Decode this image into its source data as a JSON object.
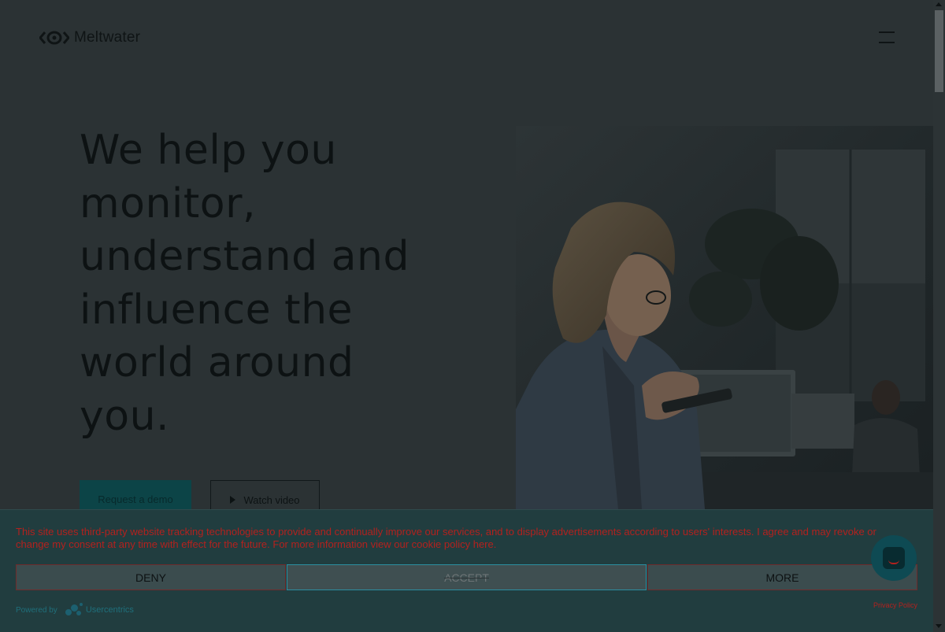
{
  "header": {
    "logo_text": "Meltwater",
    "menu_icon": "hamburger-menu-icon"
  },
  "hero": {
    "title": "We help you monitor, understand and influence the world around you.",
    "primary_button": "Request a demo",
    "secondary_button": "Watch video",
    "secondary_icon": "play-icon"
  },
  "consent": {
    "text_main": "This site uses third-party website tracking technologies to provide and continually improve our services, and to display advertisements according to users' interests. I agree and may revoke or change my consent at any time with effect for the future. For more information view our ",
    "text_link": "cookie policy here",
    "text_end": ".",
    "deny_label": "DENY",
    "accept_label": "ACCEPT",
    "more_label": "MORE",
    "powered_by": "Powered by",
    "powered_brand": "Usercentrics",
    "privacy_policy": "Privacy Policy"
  },
  "colors": {
    "overlay_bg": "#2b3234",
    "consent_bg": "#213d3f",
    "consent_text": "#b3211e",
    "accept_border": "#2c8ea0"
  }
}
